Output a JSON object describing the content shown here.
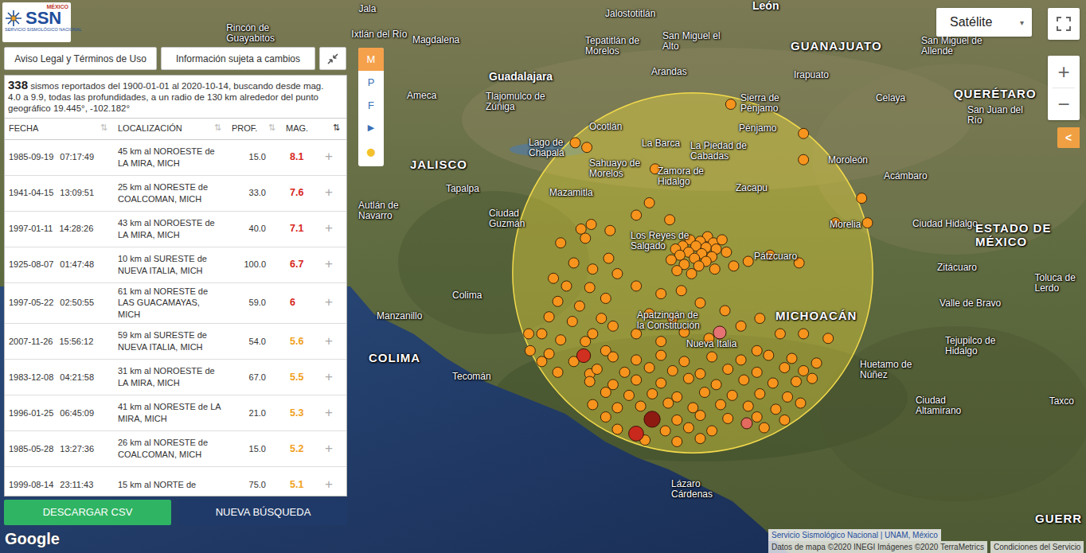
{
  "logo": {
    "country": "MÉXICO",
    "acronym": "SSN",
    "name": "SERVICIO SISMOLÓGICO NACIONAL"
  },
  "header_buttons": [
    "Aviso Legal y Términos de Uso",
    "Información sujeta a cambios"
  ],
  "summary": {
    "count": "338",
    "text": " sismos reportados del 1900-01-01 al 2020-10-14, buscando desde mag. 4.0 a 9.9, todas las profundidades, a un radio de 130 km alrededor del punto geográfico 19.445°, -102.182°"
  },
  "table": {
    "columns": [
      {
        "label": "FECHA",
        "sort_icon": "⇅",
        "sorted": false
      },
      {
        "label": "LOCALIZACIÓN",
        "sort_icon": "⇅",
        "sorted": false
      },
      {
        "label": "PROF.",
        "sort_icon": "⇅",
        "sorted": false
      },
      {
        "label": "MAG.",
        "sort_icon": "⇅",
        "sorted": true
      }
    ],
    "rows": [
      {
        "date": "1985-09-19",
        "time": "07:17:49",
        "location": "45 km al NOROESTE de LA MIRA, MICH",
        "depth": "15.0",
        "mag": "8.1",
        "color": "#d7261e",
        "action": "+"
      },
      {
        "date": "1941-04-15",
        "time": "13:09:51",
        "location": "25 km al NORESTE de COALCOMAN, MICH",
        "depth": "33.0",
        "mag": "7.6",
        "color": "#d7261e",
        "action": "+"
      },
      {
        "date": "1997-01-11",
        "time": "14:28:26",
        "location": "43 km al NOROESTE de LA MIRA, MICH",
        "depth": "40.0",
        "mag": "7.1",
        "color": "#d7261e",
        "action": "+"
      },
      {
        "date": "1925-08-07",
        "time": "01:47:48",
        "location": "10 km al SURESTE de NUEVA ITALIA, MICH",
        "depth": "100.0",
        "mag": "6.7",
        "color": "#d7261e",
        "action": "+"
      },
      {
        "date": "1997-05-22",
        "time": "02:50:55",
        "location": "61 km al NORESTE de LAS GUACAMAYAS, MICH",
        "depth": "59.0",
        "mag": "6",
        "color": "#d7261e",
        "action": "+"
      },
      {
        "date": "2007-11-26",
        "time": "15:56:12",
        "location": "59 km al SURESTE de NUEVA ITALIA, MICH",
        "depth": "54.0",
        "mag": "5.6",
        "color": "#f0a020",
        "action": "+"
      },
      {
        "date": "1983-12-08",
        "time": "04:21:58",
        "location": "31 km al NOROESTE de LA MIRA, MICH",
        "depth": "67.0",
        "mag": "5.5",
        "color": "#f0a020",
        "action": "+"
      },
      {
        "date": "1996-01-25",
        "time": "06:45:09",
        "location": "41 km al NORESTE de LA MIRA, MICH",
        "depth": "21.0",
        "mag": "5.3",
        "color": "#f0a020",
        "action": "+"
      },
      {
        "date": "1985-05-28",
        "time": "13:27:36",
        "location": "26 km al NORESTE de COALCOMAN, MICH",
        "depth": "15.0",
        "mag": "5.2",
        "color": "#f0a020",
        "action": "+"
      },
      {
        "date": "1999-08-14",
        "time": "23:11:43",
        "location": "15 km al NORTE de",
        "depth": "75.0",
        "mag": "5.1",
        "color": "#f0a020",
        "action": "+"
      }
    ]
  },
  "footer_buttons": [
    {
      "label": "DESCARGAR CSV",
      "kind": "download"
    },
    {
      "label": "NUEVA BÚSQUEDA",
      "kind": "search"
    }
  ],
  "layer_toolbar": [
    {
      "label": "M",
      "selected": true,
      "kind": "letter"
    },
    {
      "label": "P",
      "selected": false,
      "kind": "letter"
    },
    {
      "label": "F",
      "selected": false,
      "kind": "letter"
    },
    {
      "label": "▶",
      "selected": false,
      "kind": "arrow"
    },
    {
      "label": "●",
      "selected": false,
      "kind": "dot"
    }
  ],
  "map_type": {
    "label": "Satélite",
    "caret": "▾"
  },
  "zoom": {
    "in": "+",
    "out": "−"
  },
  "collapse_tab": "<",
  "map": {
    "search_area": {
      "lat": 19.445,
      "lon": -102.182,
      "radius_km": 130
    },
    "labels": [
      {
        "text": "Jala",
        "lat": 21.155,
        "lon": -104.48,
        "kind": "city"
      },
      {
        "text": "Rincón de Guayabitos",
        "lat": 21.0,
        "lon": -105.39,
        "kind": "city"
      },
      {
        "text": "Ixtlán del Río",
        "lat": 20.99,
        "lon": -104.53,
        "kind": "city"
      },
      {
        "text": "Magdalena",
        "lat": 20.953,
        "lon": -104.11,
        "kind": "city"
      },
      {
        "text": "Jalostotitlán",
        "lat": 21.124,
        "lon": -102.784,
        "kind": "city"
      },
      {
        "text": "Tepatitlán de Morelos",
        "lat": 20.917,
        "lon": -102.921,
        "kind": "city"
      },
      {
        "text": "San Miguel el Alto",
        "lat": 20.948,
        "lon": -102.39,
        "kind": "city"
      },
      {
        "text": "León",
        "lat": 21.175,
        "lon": -101.771,
        "kind": "metro"
      },
      {
        "text": "GUANAJUATO",
        "lat": 20.917,
        "lon": -101.508,
        "kind": "state"
      },
      {
        "text": "San Miguel de Allende",
        "lat": 20.917,
        "lon": -100.61,
        "kind": "city"
      },
      {
        "text": "Guadalajara",
        "lat": 20.716,
        "lon": -103.584,
        "kind": "metro"
      },
      {
        "text": "Tlajomulco de Zúñiga",
        "lat": 20.555,
        "lon": -103.606,
        "kind": "city"
      },
      {
        "text": "Ameca",
        "lat": 20.592,
        "lon": -104.148,
        "kind": "city"
      },
      {
        "text": "Arandas",
        "lat": 20.747,
        "lon": -102.467,
        "kind": "city"
      },
      {
        "text": "Irapuato",
        "lat": 20.726,
        "lon": -101.487,
        "kind": "city"
      },
      {
        "text": "Celaya",
        "lat": 20.576,
        "lon": -100.923,
        "kind": "city"
      },
      {
        "text": "QUERÉTARO",
        "lat": 20.607,
        "lon": -100.386,
        "kind": "state"
      },
      {
        "text": "San Juan del Río",
        "lat": 20.468,
        "lon": -100.293,
        "kind": "city"
      },
      {
        "text": "Sierra de Pénjamo",
        "lat": 20.545,
        "lon": -101.853,
        "kind": "city"
      },
      {
        "text": "Pénjamo",
        "lat": 20.38,
        "lon": -101.864,
        "kind": "city"
      },
      {
        "text": "Ocotlán",
        "lat": 20.39,
        "lon": -102.894,
        "kind": "city"
      },
      {
        "text": "Lago de Chapala",
        "lat": 20.256,
        "lon": -103.31,
        "kind": "city"
      },
      {
        "text": "La Barca",
        "lat": 20.282,
        "lon": -102.532,
        "kind": "city"
      },
      {
        "text": "La Piedad de Cabadas",
        "lat": 20.235,
        "lon": -102.198,
        "kind": "city"
      },
      {
        "text": "Moroleón",
        "lat": 20.173,
        "lon": -101.251,
        "kind": "city"
      },
      {
        "text": "Acámbaro",
        "lat": 20.07,
        "lon": -100.868,
        "kind": "city"
      },
      {
        "text": "JALISCO",
        "lat": 20.147,
        "lon": -104.126,
        "kind": "state"
      },
      {
        "text": "Tapalpa",
        "lat": 19.987,
        "lon": -103.88,
        "kind": "city"
      },
      {
        "text": "Sahuayo de Morelos",
        "lat": 20.122,
        "lon": -102.894,
        "kind": "city"
      },
      {
        "text": "Zamora de Hidalgo",
        "lat": 20.07,
        "lon": -102.423,
        "kind": "city"
      },
      {
        "text": "Mazamitla",
        "lat": 19.962,
        "lon": -103.168,
        "kind": "city"
      },
      {
        "text": "Ciudad Guzmán",
        "lat": 19.796,
        "lon": -103.584,
        "kind": "city"
      },
      {
        "text": "Autlán de Navarro",
        "lat": 19.848,
        "lon": -104.482,
        "kind": "city"
      },
      {
        "text": "Zacapu",
        "lat": 19.992,
        "lon": -101.886,
        "kind": "city"
      },
      {
        "text": "Morelia",
        "lat": 19.755,
        "lon": -101.24,
        "kind": "city"
      },
      {
        "text": "Ciudad Hidalgo",
        "lat": 19.76,
        "lon": -100.671,
        "kind": "city"
      },
      {
        "text": "ESTADO DE MÉXICO",
        "lat": 19.693,
        "lon": -100.238,
        "kind": "state"
      },
      {
        "text": "Los Reyes de Salgado",
        "lat": 19.652,
        "lon": -102.609,
        "kind": "city"
      },
      {
        "text": "Pátzcuaro",
        "lat": 19.548,
        "lon": -101.76,
        "kind": "city"
      },
      {
        "text": "Zitácuaro",
        "lat": 19.476,
        "lon": -100.501,
        "kind": "city"
      },
      {
        "text": "Toluca de Lerdo",
        "lat": 19.38,
        "lon": -99.83,
        "kind": "city"
      },
      {
        "text": "Valle de Bravo",
        "lat": 19.244,
        "lon": -100.484,
        "kind": "city"
      },
      {
        "text": "Colima",
        "lat": 19.295,
        "lon": -103.836,
        "kind": "city"
      },
      {
        "text": "Manzanillo",
        "lat": 19.161,
        "lon": -104.356,
        "kind": "city"
      },
      {
        "text": "COLIMA",
        "lat": 18.892,
        "lon": -104.411,
        "kind": "state"
      },
      {
        "text": "Tecomán",
        "lat": 18.768,
        "lon": -103.836,
        "kind": "city"
      },
      {
        "text": "Apatzingán de la Constitución",
        "lat": 19.135,
        "lon": -102.565,
        "kind": "city"
      },
      {
        "text": "Nueva Italia",
        "lat": 18.98,
        "lon": -102.226,
        "kind": "city"
      },
      {
        "text": "MICHOACÁN",
        "lat": 19.166,
        "lon": -101.612,
        "kind": "state"
      },
      {
        "text": "Tejupilco de Hidalgo",
        "lat": 18.97,
        "lon": -100.446,
        "kind": "city"
      },
      {
        "text": "Huetamo de Núñez",
        "lat": 18.815,
        "lon": -101.032,
        "kind": "city"
      },
      {
        "text": "Ciudad Altamirano",
        "lat": 18.582,
        "lon": -100.649,
        "kind": "city"
      },
      {
        "text": "Taxco",
        "lat": 18.608,
        "lon": -99.73,
        "kind": "city"
      },
      {
        "text": "Lázaro Cárdenas",
        "lat": 18.04,
        "lon": -102.33,
        "kind": "city"
      },
      {
        "text": "GUERR",
        "lat": 17.849,
        "lon": -99.827,
        "kind": "state"
      }
    ],
    "points": [
      [
        19.68,
        -102.08
      ],
      [
        19.66,
        -102.2
      ],
      [
        19.65,
        -102.13
      ],
      [
        19.64,
        -102.04
      ],
      [
        19.62,
        -102.25
      ],
      [
        19.62,
        -102.16
      ],
      [
        19.61,
        -102.09
      ],
      [
        19.6,
        -102.3
      ],
      [
        19.6,
        -102.02
      ],
      [
        19.58,
        -102.21
      ],
      [
        19.57,
        -102.12
      ],
      [
        19.56,
        -102.27
      ],
      [
        19.55,
        -102.05
      ],
      [
        19.54,
        -102.17
      ],
      [
        19.53,
        -102.33
      ],
      [
        19.52,
        -102.09
      ],
      [
        19.5,
        -102.24
      ],
      [
        19.49,
        -102.14
      ],
      [
        19.47,
        -102.03
      ],
      [
        19.46,
        -102.29
      ],
      [
        19.44,
        -102.19
      ],
      [
        19.66,
        -101.98
      ],
      [
        19.58,
        -101.95
      ],
      [
        19.49,
        -101.9
      ],
      [
        19.82,
        -102.57
      ],
      [
        19.79,
        -102.34
      ],
      [
        19.9,
        -102.48
      ],
      [
        20.12,
        -102.44
      ],
      [
        19.72,
        -102.75
      ],
      [
        19.73,
        -102.95
      ],
      [
        19.76,
        -102.88
      ],
      [
        19.52,
        -101.8
      ],
      [
        19.56,
        -101.65
      ],
      [
        19.51,
        -101.45
      ],
      [
        19.77,
        -101.2
      ],
      [
        19.77,
        -100.98
      ],
      [
        19.93,
        -101.02
      ],
      [
        20.35,
        -101.42
      ],
      [
        20.18,
        -101.42
      ],
      [
        20.54,
        -101.92
      ],
      [
        20.29,
        -102.99
      ],
      [
        20.26,
        -102.91
      ],
      [
        19.64,
        -103.09
      ],
      [
        19.67,
        -102.92
      ],
      [
        19.54,
        -102.76
      ],
      [
        19.51,
        -103.0
      ],
      [
        19.41,
        -103.14
      ],
      [
        19.47,
        -102.87
      ],
      [
        19.44,
        -102.7
      ],
      [
        19.36,
        -103.05
      ],
      [
        19.35,
        -102.89
      ],
      [
        19.28,
        -102.78
      ],
      [
        19.26,
        -103.11
      ],
      [
        19.23,
        -102.96
      ],
      [
        19.15,
        -102.81
      ],
      [
        19.16,
        -103.17
      ],
      [
        19.13,
        -103.01
      ],
      [
        19.05,
        -102.87
      ],
      [
        19.1,
        -102.73
      ],
      [
        19.05,
        -103.22
      ],
      [
        19.01,
        -103.09
      ],
      [
        19.0,
        -102.92
      ],
      [
        18.94,
        -102.78
      ],
      [
        19.05,
        -103.31
      ],
      [
        18.92,
        -103.17
      ],
      [
        18.87,
        -103.0
      ],
      [
        18.8,
        -103.11
      ],
      [
        18.79,
        -102.89
      ],
      [
        18.94,
        -103.3
      ],
      [
        18.87,
        -103.22
      ],
      [
        19.36,
        -102.57
      ],
      [
        19.31,
        -102.4
      ],
      [
        19.33,
        -102.26
      ],
      [
        19.18,
        -102.48
      ],
      [
        19.15,
        -102.32
      ],
      [
        19.25,
        -102.13
      ],
      [
        19.05,
        -102.57
      ],
      [
        19.0,
        -102.4
      ],
      [
        19.06,
        -102.24
      ],
      [
        19.02,
        -102.07
      ],
      [
        19.2,
        -101.96
      ],
      [
        19.1,
        -101.85
      ],
      [
        19.15,
        -101.72
      ],
      [
        19.05,
        -101.58
      ],
      [
        19.05,
        -101.42
      ],
      [
        18.94,
        -101.74
      ],
      [
        19.02,
        -101.25
      ],
      [
        18.9,
        -102.73
      ],
      [
        18.88,
        -102.57
      ],
      [
        18.91,
        -102.4
      ],
      [
        18.87,
        -102.24
      ],
      [
        18.9,
        -102.05
      ],
      [
        18.88,
        -101.85
      ],
      [
        18.91,
        -101.66
      ],
      [
        18.89,
        -101.5
      ],
      [
        18.86,
        -101.33
      ],
      [
        18.82,
        -102.84
      ],
      [
        18.8,
        -102.65
      ],
      [
        18.83,
        -102.48
      ],
      [
        18.81,
        -102.32
      ],
      [
        18.79,
        -102.13
      ],
      [
        18.82,
        -101.94
      ],
      [
        18.8,
        -101.74
      ],
      [
        18.83,
        -101.55
      ],
      [
        18.81,
        -101.42
      ],
      [
        18.74,
        -102.89
      ],
      [
        18.72,
        -102.73
      ],
      [
        18.75,
        -102.57
      ],
      [
        18.73,
        -102.4
      ],
      [
        18.76,
        -102.21
      ],
      [
        18.72,
        -102.02
      ],
      [
        18.75,
        -101.83
      ],
      [
        18.73,
        -101.63
      ],
      [
        18.74,
        -101.47
      ],
      [
        18.76,
        -101.36
      ],
      [
        18.67,
        -102.78
      ],
      [
        18.65,
        -102.62
      ],
      [
        18.66,
        -102.46
      ],
      [
        18.64,
        -102.29
      ],
      [
        18.67,
        -102.1
      ],
      [
        18.65,
        -101.91
      ],
      [
        18.66,
        -101.72
      ],
      [
        18.64,
        -101.53
      ],
      [
        18.59,
        -102.87
      ],
      [
        18.57,
        -102.7
      ],
      [
        18.58,
        -102.54
      ],
      [
        18.6,
        -102.35
      ],
      [
        18.57,
        -102.18
      ],
      [
        18.59,
        -101.99
      ],
      [
        18.58,
        -101.8
      ],
      [
        18.56,
        -101.61
      ],
      [
        18.6,
        -101.44
      ],
      [
        18.51,
        -102.78
      ],
      [
        18.49,
        -102.29
      ],
      [
        18.52,
        -102.13
      ],
      [
        18.5,
        -101.94
      ],
      [
        18.51,
        -101.74
      ],
      [
        18.49,
        -101.55
      ],
      [
        18.43,
        -102.7
      ],
      [
        18.42,
        -102.37
      ],
      [
        18.44,
        -102.21
      ],
      [
        18.42,
        -102.05
      ],
      [
        18.44,
        -101.69
      ],
      [
        18.36,
        -102.51
      ],
      [
        18.35,
        -102.29
      ],
      [
        18.37,
        -102.13
      ]
    ],
    "major_points": [
      {
        "lat": 18.495,
        "lon": -102.461,
        "mag": 8.1,
        "color": "#8e1b12"
      },
      {
        "lat": 18.402,
        "lon": -102.571,
        "mag": 7.6,
        "color": "#c9291c"
      },
      {
        "lat": 18.908,
        "lon": -102.932,
        "mag": 7.1,
        "color": "#d0301f"
      },
      {
        "lat": 19.058,
        "lon": -101.996,
        "mag": 6.7,
        "color": "#e57373"
      },
      {
        "lat": 18.469,
        "lon": -101.81,
        "mag": 6.0,
        "color": "#e26a5e"
      }
    ]
  },
  "attribution": {
    "google": "Google",
    "source": "Servicio Sismológico Nacional | UNAM, México",
    "data": "Datos de mapa ©2020 INEGI Imágenes ©2020 TerraMetrics",
    "terms": "Condiciones del Servicio"
  }
}
